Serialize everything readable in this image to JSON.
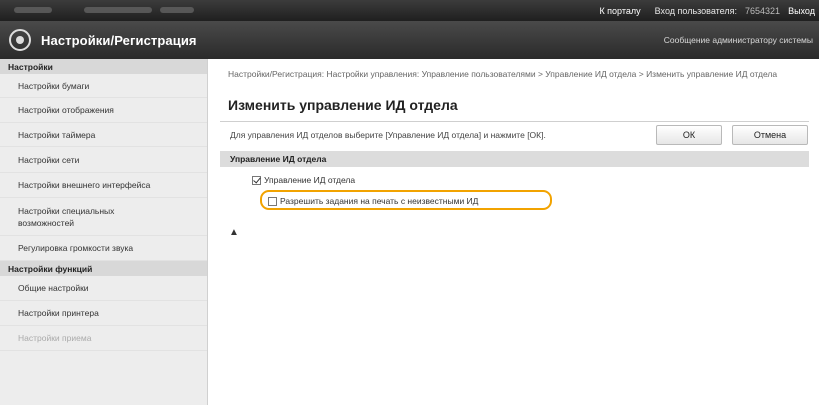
{
  "topbar": {
    "portal_link": "К порталу",
    "login_label": "Вход пользователя:",
    "user_id": "7654321",
    "logout": "Выход"
  },
  "titlebar": {
    "title": "Настройки/Регистрация",
    "admin_message": "Сообщение администратору системы"
  },
  "sidebar": {
    "groups": [
      {
        "label": "Настройки",
        "items": [
          "Настройки бумаги",
          "Настройки отображения",
          "Настройки таймера",
          "Настройки сети",
          "Настройки внешнего интерфейса",
          "Настройки специальных возможностей",
          "Регулировка громкости звука"
        ]
      },
      {
        "label": "Настройки функций",
        "items": [
          "Общие настройки",
          "Настройки принтера",
          "Настройки приема"
        ]
      }
    ]
  },
  "main": {
    "breadcrumb": "Настройки/Регистрация: Настройки управления: Управление пользователями > Управление ИД отдела > Изменить управление ИД отдела",
    "page_title": "Изменить управление ИД отдела",
    "instruction": "Для управления ИД отделов выберите [Управление ИД отдела] и нажмите [ОК].",
    "ok_button": "ОК",
    "cancel_button": "Отмена",
    "section_header": "Управление ИД отдела",
    "option_dept_id_mgmt": {
      "label": "Управление ИД отдела",
      "checked": true
    },
    "option_allow_unknown": {
      "label": "Разрешить задания на печать с неизвестными ИД",
      "checked": false
    },
    "top_link": "▲",
    "highlight_color": "#f2a300"
  }
}
